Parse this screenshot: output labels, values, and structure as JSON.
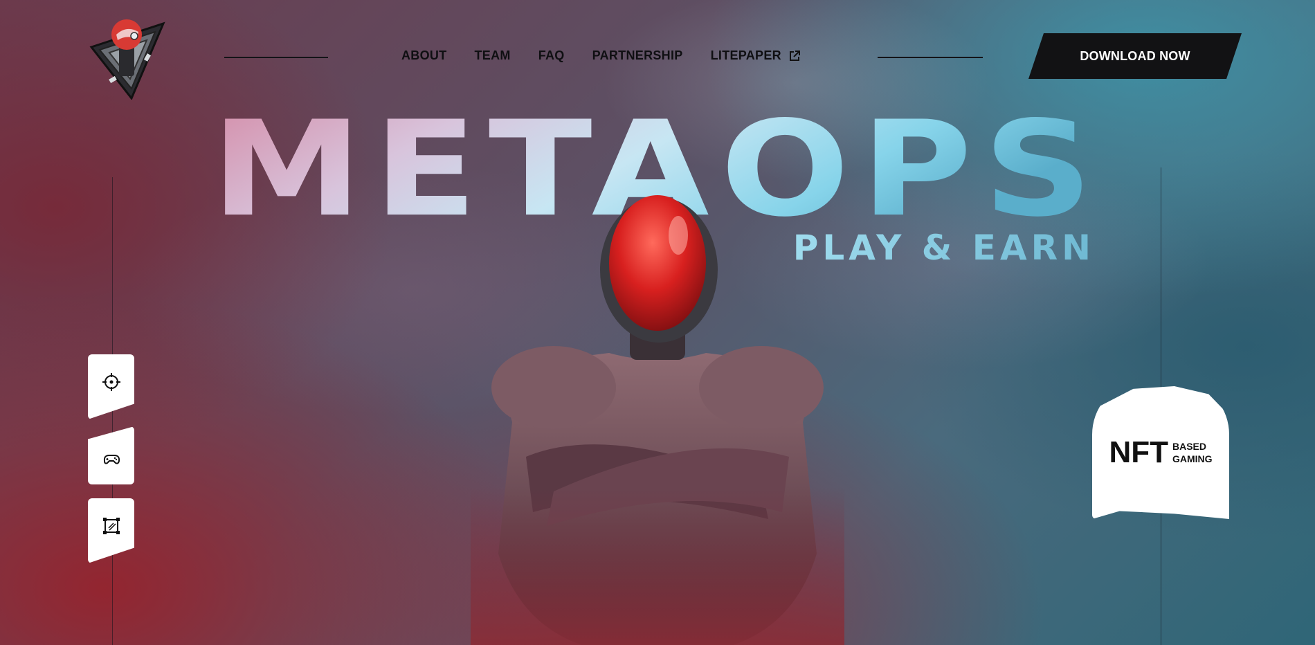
{
  "brand": {
    "logo_icon": "helmet-soldier-logo"
  },
  "nav": {
    "items": [
      {
        "label": "ABOUT"
      },
      {
        "label": "TEAM"
      },
      {
        "label": "FAQ"
      },
      {
        "label": "PARTNERSHIP"
      },
      {
        "label": "LITEPAPER",
        "icon": "external-link-icon"
      }
    ]
  },
  "cta": {
    "download_label": "DOWNLOAD NOW"
  },
  "hero": {
    "title": "METAOPS",
    "subtitle": "PLAY & EARN",
    "figure_icon": "armored-soldier-red-helmet"
  },
  "side_buttons": [
    {
      "icon": "crosshair-icon"
    },
    {
      "icon": "gamepad-icon"
    },
    {
      "icon": "frame-icon"
    }
  ],
  "badge": {
    "main": "NFT",
    "line1": "BASED",
    "line2": "GAMING"
  },
  "colors": {
    "dark": "#121214",
    "accent_red": "#d62b2b",
    "title_pink": "#d98aa8",
    "title_cyan": "#7fd6ec"
  }
}
